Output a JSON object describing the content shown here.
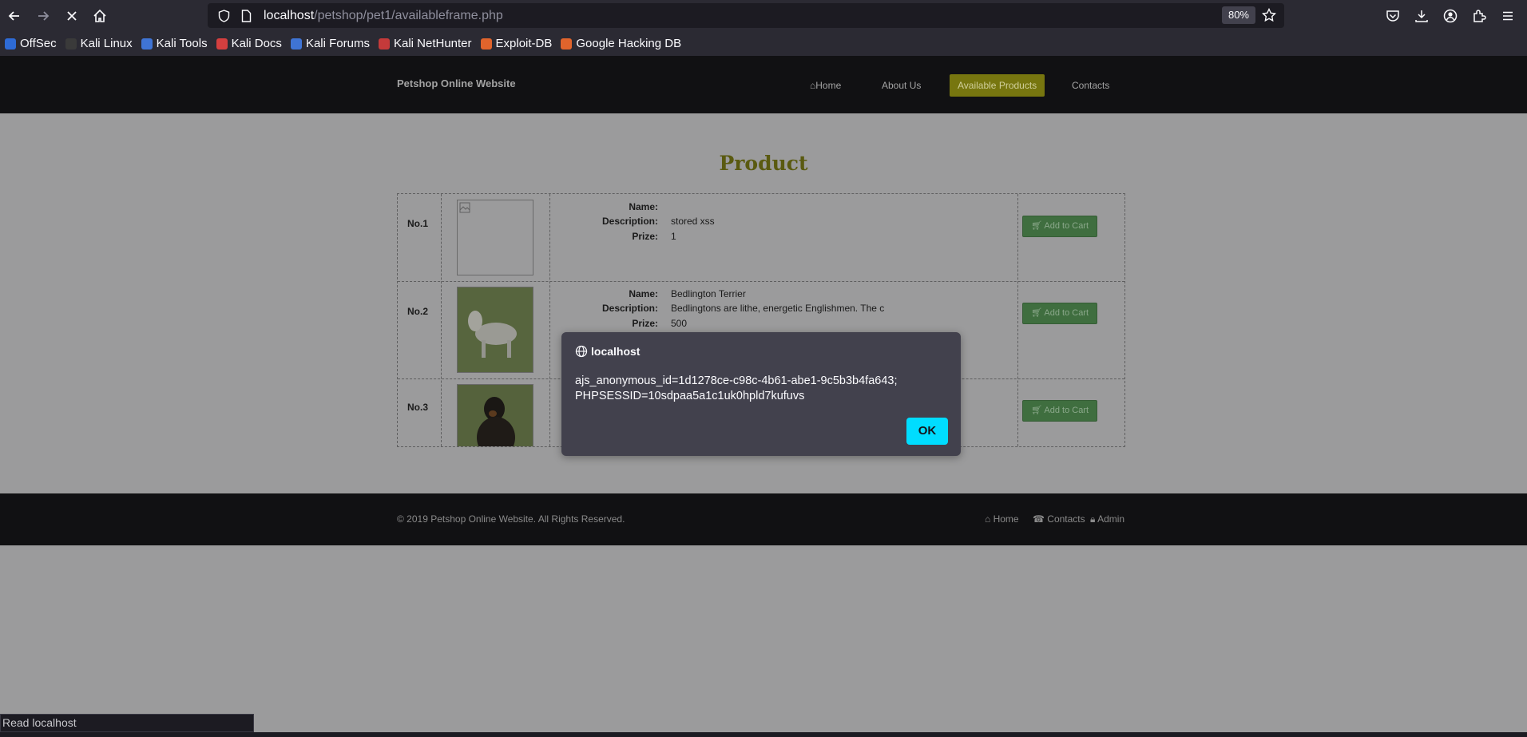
{
  "browser": {
    "url_host": "localhost",
    "url_path": "/petshop/pet1/availableframe.php",
    "zoom": "80%",
    "bookmarks": [
      {
        "label": "OffSec",
        "color": "#2e6bd6"
      },
      {
        "label": "Kali Linux",
        "color": "#3a3a3a"
      },
      {
        "label": "Kali Tools",
        "color": "#3f74d4"
      },
      {
        "label": "Kali Docs",
        "color": "#d43f3f"
      },
      {
        "label": "Kali Forums",
        "color": "#3f74d4"
      },
      {
        "label": "Kali NetHunter",
        "color": "#c53a3a"
      },
      {
        "label": "Exploit-DB",
        "color": "#e0642c"
      },
      {
        "label": "Google Hacking DB",
        "color": "#e0642c"
      }
    ],
    "status_text": "Read localhost"
  },
  "site": {
    "brand": "Petshop Online Website",
    "nav": {
      "home": "Home",
      "about": "About Us",
      "products": "Available Products",
      "contacts": "Contacts"
    },
    "page_title": "Product",
    "labels": {
      "name": "Name:",
      "description": "Description:",
      "prize": "Prize:",
      "cart": "Add to Cart"
    },
    "products": [
      {
        "no": "No.1",
        "name": "",
        "description": "stored xss",
        "prize": "1"
      },
      {
        "no": "No.2",
        "name": "Bedlington Terrier",
        "description": "Bedlingtons are lithe, energetic Englishmen. The c",
        "prize": "500"
      },
      {
        "no": "No.3",
        "name": "",
        "description": "",
        "prize": ""
      }
    ],
    "footer": {
      "copyright": "© 2019 Petshop Online Website. All Rights Reserved.",
      "home": "Home",
      "contacts": "Contacts",
      "admin": "Admin"
    }
  },
  "dialog": {
    "title": "localhost",
    "message_line1": "ajs_anonymous_id=1d1278ce-c98c-4b61-abe1-9c5b3b4fa643;",
    "message_line2": "PHPSESSID=10sdpaa5a1c1uk0hpld7kufuvs",
    "ok_label": "OK"
  },
  "colors": {
    "accent": "#00ddff",
    "active_nav": "#77760f",
    "product_title": "#5a5a10",
    "cart_button": "#3f6e3f"
  }
}
